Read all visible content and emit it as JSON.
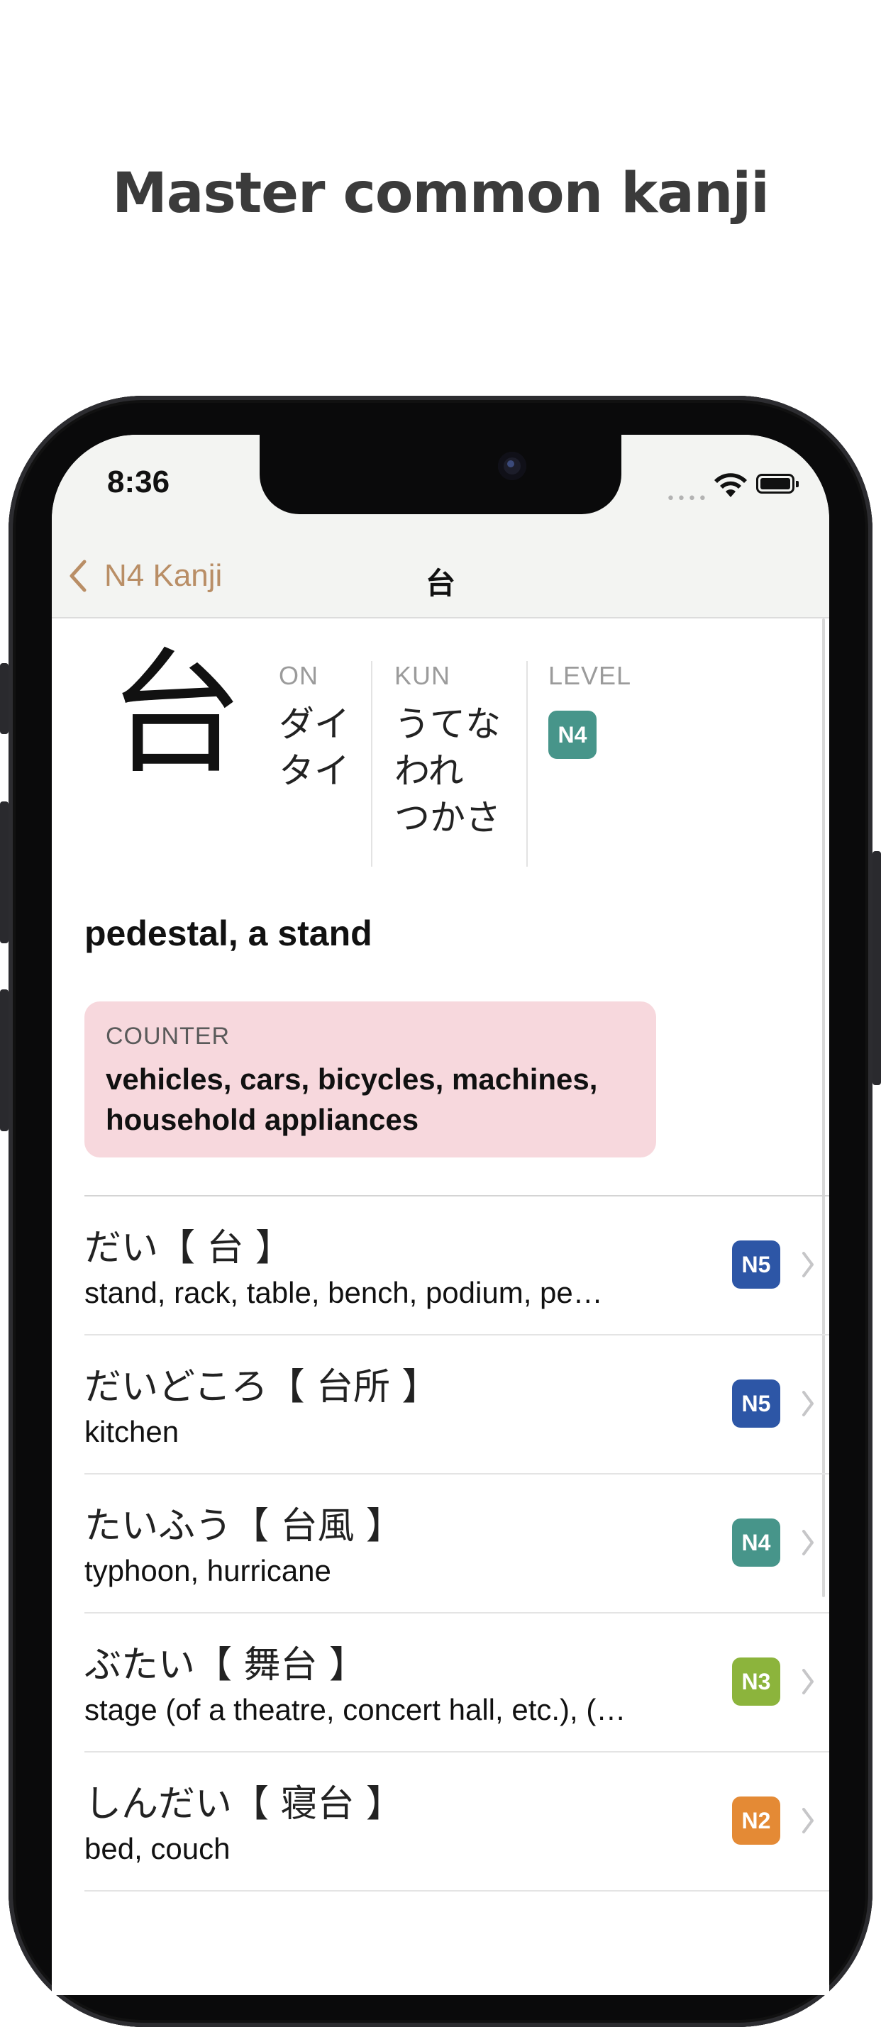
{
  "headline": "Master common kanji",
  "status_bar": {
    "time": "8:36",
    "signal": "••••"
  },
  "nav": {
    "back_label": "N4 Kanji",
    "title": "台"
  },
  "kanji": {
    "character": "台",
    "on_label": "ON",
    "on_readings": [
      "ダイ",
      "タイ"
    ],
    "kun_label": "KUN",
    "kun_readings": [
      "うてな",
      "われ",
      "つかさ"
    ],
    "level_label": "LEVEL",
    "level": "N4",
    "meaning": "pedestal, a stand",
    "counter_label": "COUNTER",
    "counter_text": "vehicles, cars, bicycles, machines, household appliances"
  },
  "colors": {
    "accent": "#b98e66",
    "N5": "#2d56a6",
    "N4": "#47958a",
    "N3": "#8cb43c",
    "N2": "#e48a35",
    "counter_bg": "#f7d8dd"
  },
  "words": [
    {
      "word": "だい【 台 】",
      "meaning": "stand, rack, table, bench, podium, pe…",
      "level": "N5",
      "color": "#2d56a6"
    },
    {
      "word": "だいどころ【 台所 】",
      "meaning": "kitchen",
      "level": "N5",
      "color": "#2d56a6"
    },
    {
      "word": "たいふう【 台風 】",
      "meaning": "typhoon, hurricane",
      "level": "N4",
      "color": "#47958a"
    },
    {
      "word": "ぶたい【 舞台 】",
      "meaning": "stage (of a theatre, concert hall, etc.), (…",
      "level": "N3",
      "color": "#8cb43c"
    },
    {
      "word": "しんだい【 寝台 】",
      "meaning": "bed, couch",
      "level": "N2",
      "color": "#e48a35"
    }
  ]
}
